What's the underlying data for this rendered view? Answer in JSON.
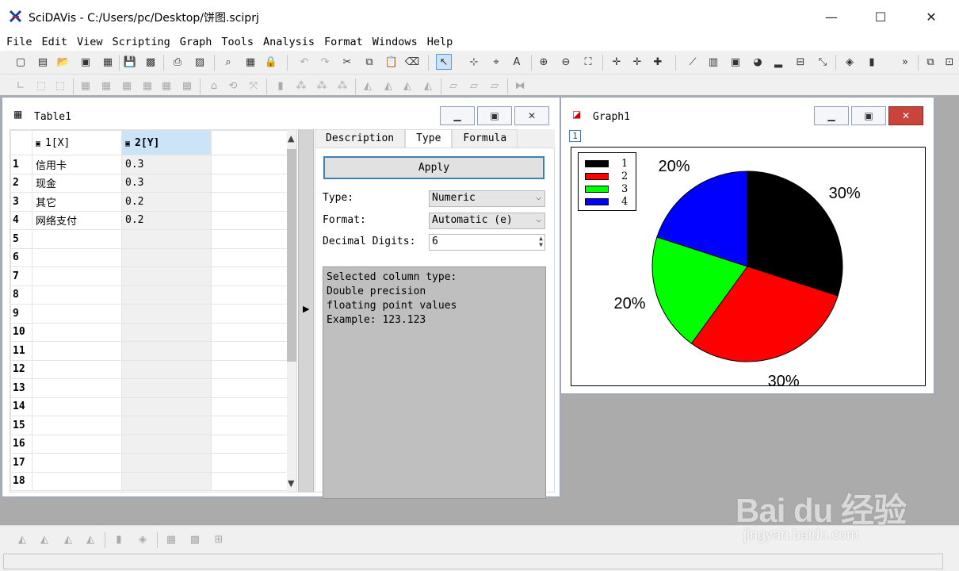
{
  "window": {
    "title": "SciDAVis - C:/Users/pc/Desktop/饼图.sciprj",
    "controls": {
      "minimize": "—",
      "maximize": "☐",
      "close": "✕"
    }
  },
  "menubar": {
    "items": [
      "File",
      "Edit",
      "View",
      "Scripting",
      "Graph",
      "Tools",
      "Analysis",
      "Format",
      "Windows",
      "Help"
    ]
  },
  "toolbar": {
    "overflow": "»"
  },
  "table_window": {
    "title": "Table1",
    "columns": [
      "1[X]",
      "2[Y]"
    ],
    "rows": [
      {
        "num": "1",
        "x": "信用卡",
        "y": "0.3"
      },
      {
        "num": "2",
        "x": "现金",
        "y": "0.3"
      },
      {
        "num": "3",
        "x": "其它",
        "y": "0.2"
      },
      {
        "num": "4",
        "x": "网络支付",
        "y": "0.2"
      },
      {
        "num": "5",
        "x": "",
        "y": ""
      },
      {
        "num": "6",
        "x": "",
        "y": ""
      },
      {
        "num": "7",
        "x": "",
        "y": ""
      },
      {
        "num": "8",
        "x": "",
        "y": ""
      },
      {
        "num": "9",
        "x": "",
        "y": ""
      },
      {
        "num": "10",
        "x": "",
        "y": ""
      },
      {
        "num": "11",
        "x": "",
        "y": ""
      },
      {
        "num": "12",
        "x": "",
        "y": ""
      },
      {
        "num": "13",
        "x": "",
        "y": ""
      },
      {
        "num": "14",
        "x": "",
        "y": ""
      },
      {
        "num": "15",
        "x": "",
        "y": ""
      },
      {
        "num": "16",
        "x": "",
        "y": ""
      },
      {
        "num": "17",
        "x": "",
        "y": ""
      },
      {
        "num": "18",
        "x": "",
        "y": ""
      }
    ]
  },
  "options_panel": {
    "tabs": [
      "Description",
      "Type",
      "Formula"
    ],
    "active_tab": "Type",
    "apply_label": "Apply",
    "type_label": "Type:",
    "type_value": "Numeric",
    "format_label": "Format:",
    "format_value": "Automatic (e)",
    "digits_label": "Decimal Digits:",
    "digits_value": "6",
    "description": "Selected column type:\nDouble precision\nfloating point values\nExample: 123.123"
  },
  "graph_window": {
    "title": "Graph1",
    "layer": "1"
  },
  "chart_data": {
    "type": "pie",
    "categories": [
      "1",
      "2",
      "3",
      "4"
    ],
    "values": [
      0.3,
      0.3,
      0.2,
      0.2
    ],
    "labels": [
      "30%",
      "30%",
      "20%",
      "20%"
    ],
    "colors": [
      "#000000",
      "#ff0000",
      "#00ff00",
      "#0000ff"
    ],
    "legend_position": "top-left",
    "start_angle_deg": 90,
    "direction": "clockwise"
  },
  "watermark": {
    "brand": "Bai du 经验",
    "url": "jingyan.baidu.com"
  }
}
